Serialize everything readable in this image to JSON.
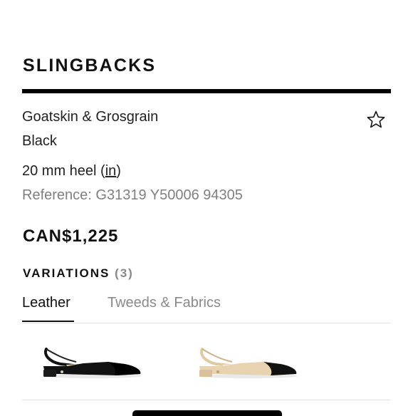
{
  "product": {
    "title": "SLINGBACKS",
    "material": "Goatskin & Grosgrain",
    "color": "Black",
    "heel_text": "20 mm heel (",
    "heel_unit_link": "in",
    "heel_close": ")",
    "reference": "Reference: G31319 Y50006 94305",
    "price": "CAN$1,225"
  },
  "variations": {
    "label": "VARIATIONS",
    "count": "(3)",
    "tabs": [
      {
        "label": "Leather",
        "active": true
      },
      {
        "label": "Tweeds & Fabrics",
        "active": false
      }
    ],
    "items": [
      {
        "name": "black slingback",
        "body_color": "#111111",
        "cap_color": "#111111"
      },
      {
        "name": "beige slingback",
        "body_color": "#e8d3b0",
        "cap_color": "#111111"
      }
    ]
  },
  "icons": {
    "wishlist": "star-outline-icon"
  },
  "colors": {
    "text": "#222222",
    "muted": "#808080",
    "rule": "#000000"
  }
}
